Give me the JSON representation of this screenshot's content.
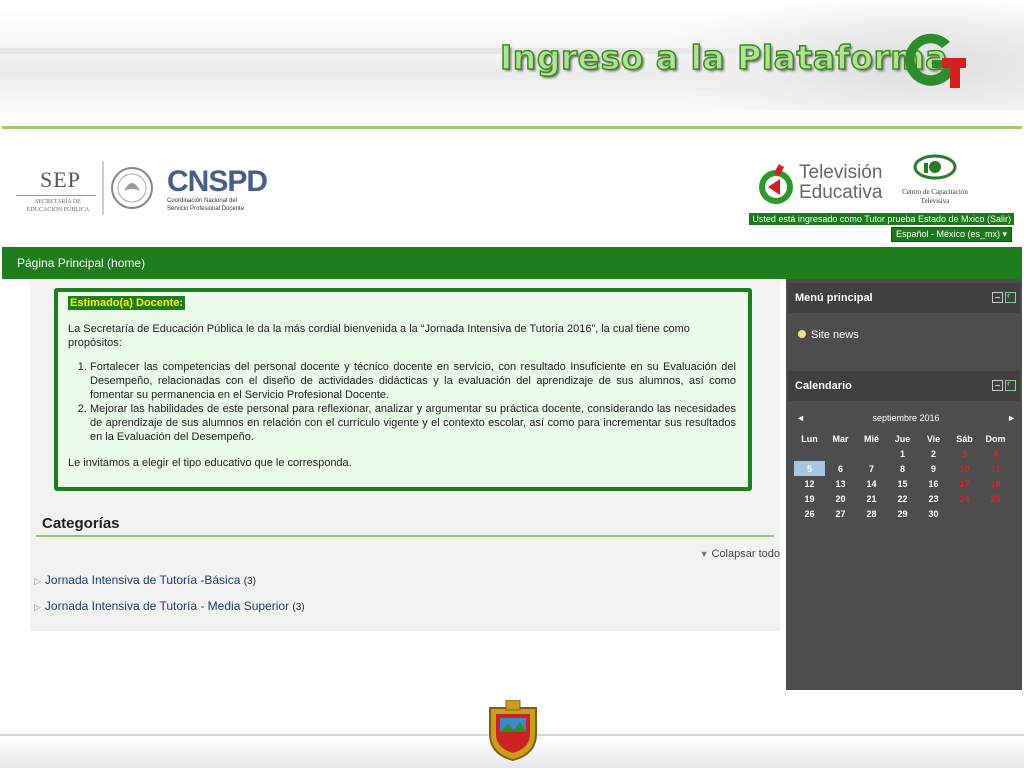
{
  "slide": {
    "title": "Ingreso a la Plataforma"
  },
  "logos": {
    "sep": {
      "word": "SEP",
      "sub": "Secretaría de Educación Pública"
    },
    "cnspd": {
      "word": "CNSPD",
      "sub_line1": "Coordinación Nacional del",
      "sub_line2": "Servicio Profesional Docente"
    },
    "tv": {
      "line1": "Televisión",
      "line2": "Educativa"
    },
    "ccat": {
      "line1": "Centro de Capacitación",
      "line2": "Televisiva"
    }
  },
  "header": {
    "login_info": "Usted está ingresado como Tutor prueba Estado de Mxico (Salir)",
    "language": "Español - México (es_mx) ▾"
  },
  "nav": {
    "home": "Página Principal (home)"
  },
  "welcome": {
    "legend": "Estimado(a) Docente:",
    "intro": "La Secretaría de Educación Pública le da la más cordial bienvenida a la “Jornada Intensiva de Tutoría 2016”, la cual tiene como propósitos:",
    "items": [
      "Fortalecer las competencias del personal docente y técnico docente en servicio, con resultado Insuficiente en su Evaluación del Desempeño, relacionadas con el diseño de actividades didácticas y la evaluación del aprendizaje de sus alumnos, así como fomentar su permanencia en el Servicio Profesional Docente.",
      "Mejorar las habilidades de este personal para reflexionar, analizar y argumentar su práctica docente, considerando las necesidades de aprendizaje de sus alumnos en relación con el currículo vigente y el contexto escolar, así como para incrementar sus resultados en la Evaluación del Desempeño."
    ],
    "closing": "Le invitamos a elegir el tipo educativo que le corresponda."
  },
  "categories": {
    "heading": "Categorías",
    "collapse_label": "Colapsar todo",
    "items": [
      {
        "label": "Jornada Intensiva de Tutoría -Básica",
        "count": "(3)"
      },
      {
        "label": "Jornada Intensiva de Tutoría - Media Superior",
        "count": "(3)"
      }
    ]
  },
  "menu": {
    "title": "Menú principal",
    "items": [
      "Site news"
    ]
  },
  "calendar": {
    "title": "Calendario",
    "month": "septiembre 2016",
    "prev": "◄",
    "next": "►",
    "days": [
      "Lun",
      "Mar",
      "Mié",
      "Jue",
      "Vie",
      "Sáb",
      "Dom"
    ],
    "weeks": [
      [
        "",
        "",
        "",
        "1",
        "2",
        "3",
        "4"
      ],
      [
        "5",
        "6",
        "7",
        "8",
        "9",
        "10",
        "11"
      ],
      [
        "12",
        "13",
        "14",
        "15",
        "16",
        "17",
        "18"
      ],
      [
        "19",
        "20",
        "21",
        "22",
        "23",
        "24",
        "25"
      ],
      [
        "26",
        "27",
        "28",
        "29",
        "30",
        "",
        ""
      ]
    ],
    "today": "5",
    "weekend_color": "#cc2a2a"
  },
  "colors": {
    "accent": "#1e7e1e",
    "legend_text": "#ffee00",
    "side_bg": "#4d4d4d"
  }
}
